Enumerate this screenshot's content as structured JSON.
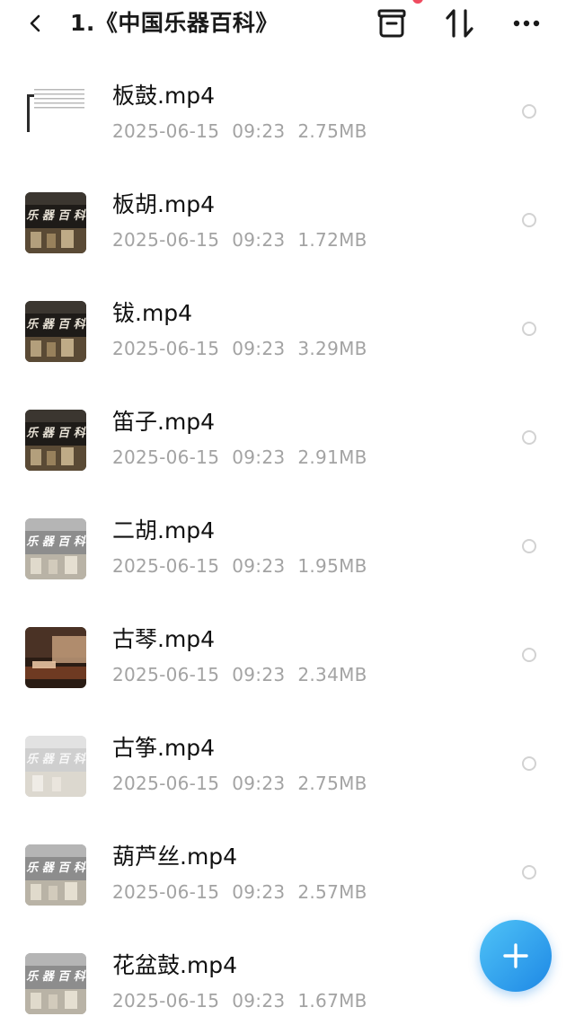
{
  "header": {
    "title": "1.《中国乐器百科》",
    "icons": {
      "back": "chevron-left-icon",
      "archive": "archive-icon",
      "sort": "sort-icon",
      "more": "more-horizontal-icon"
    }
  },
  "files": [
    {
      "name": "板鼓.mp4",
      "date": "2025-06-15",
      "time": "09:23",
      "size": "2.75MB",
      "thumb": "document"
    },
    {
      "name": "板胡.mp4",
      "date": "2025-06-15",
      "time": "09:23",
      "size": "1.72MB",
      "thumb": "dark"
    },
    {
      "name": "钹.mp4",
      "date": "2025-06-15",
      "time": "09:23",
      "size": "3.29MB",
      "thumb": "dark"
    },
    {
      "name": "笛子.mp4",
      "date": "2025-06-15",
      "time": "09:23",
      "size": "2.91MB",
      "thumb": "dark"
    },
    {
      "name": "二胡.mp4",
      "date": "2025-06-15",
      "time": "09:23",
      "size": "1.95MB",
      "thumb": "gray"
    },
    {
      "name": "古琴.mp4",
      "date": "2025-06-15",
      "time": "09:23",
      "size": "2.34MB",
      "thumb": "photo"
    },
    {
      "name": "古筝.mp4",
      "date": "2025-06-15",
      "time": "09:23",
      "size": "2.75MB",
      "thumb": "light"
    },
    {
      "name": "葫芦丝.mp4",
      "date": "2025-06-15",
      "time": "09:23",
      "size": "2.57MB",
      "thumb": "gray"
    },
    {
      "name": "花盆鼓.mp4",
      "date": "2025-06-15",
      "time": "09:23",
      "size": "1.67MB",
      "thumb": "gray"
    }
  ],
  "thumb_banner_text": "乐 器 百 科",
  "fab": {
    "icon": "plus-icon"
  },
  "colors": {
    "fab_start": "#4fc3f7",
    "fab_end": "#1e88e5",
    "notification_dot": "#ef4b5f",
    "meta_text": "#a3a3a3"
  }
}
